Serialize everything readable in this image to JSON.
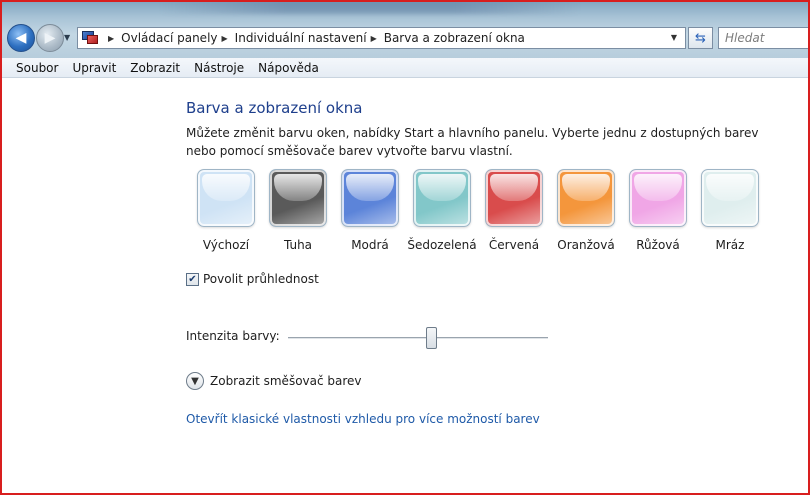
{
  "breadcrumb": [
    "Ovládací panely",
    "Individuální nastavení",
    "Barva a zobrazení okna"
  ],
  "search": {
    "placeholder": "Hledat"
  },
  "menu": [
    "Soubor",
    "Upravit",
    "Zobrazit",
    "Nástroje",
    "Nápověda"
  ],
  "page": {
    "title": "Barva a zobrazení okna",
    "description": "Můžete změnit barvu oken, nabídky Start a hlavního panelu. Vyberte jednu z dostupných barev nebo pomocí směšovače barev vytvořte barvu vlastní."
  },
  "swatches": [
    {
      "label": "Výchozí",
      "color": "#cfe3f5"
    },
    {
      "label": "Tuha",
      "color": "#5a5a5a"
    },
    {
      "label": "Modrá",
      "color": "#5c84d9"
    },
    {
      "label": "Šedozelená",
      "color": "#82c7c9"
    },
    {
      "label": "Červená",
      "color": "#d94c4c"
    },
    {
      "label": "Oranžová",
      "color": "#f4963c"
    },
    {
      "label": "Růžová",
      "color": "#f0a6e6"
    },
    {
      "label": "Mráz",
      "color": "#dfeeee"
    }
  ],
  "transparency": {
    "label": "Povolit průhlednost",
    "checked": true
  },
  "intensity": {
    "label": "Intenzita barvy:",
    "value_fraction": 0.55
  },
  "mixer": {
    "label": "Zobrazit směšovač barev"
  },
  "classic_link": "Otevřít klasické vlastnosti vzhledu pro více možností barev",
  "icons": {
    "back": "back-arrow-icon",
    "forward": "forward-arrow-icon",
    "refresh": "refresh-icon",
    "control_panel": "control-panel-icon",
    "chevron": "chevron-down-icon",
    "checkmark": "checkmark-icon"
  }
}
